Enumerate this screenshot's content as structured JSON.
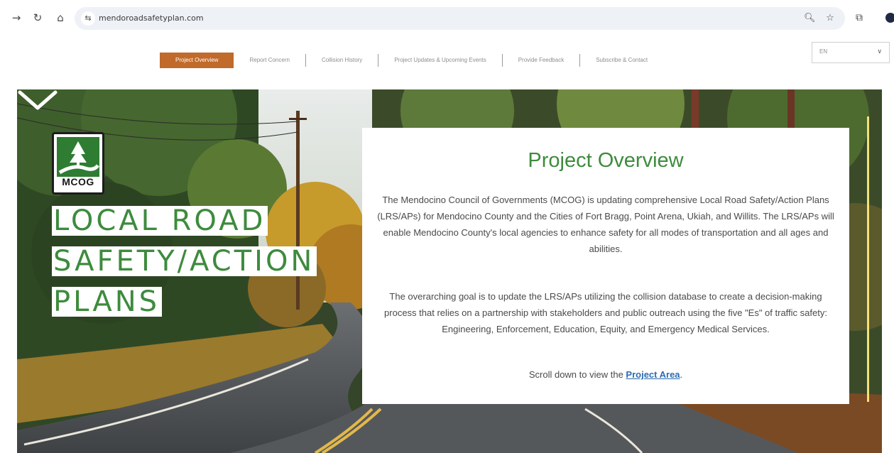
{
  "browser": {
    "url": "mendoroadsafetyplan.com",
    "icons": {
      "back": "arrow-right-icon",
      "reload": "reload-icon",
      "home": "home-icon",
      "site_settings": "tune-icon",
      "zoom": "zoom-icon",
      "bookmark": "star-icon",
      "extensions": "puzzle-icon",
      "profile": "profile-icon"
    }
  },
  "site_nav": {
    "items": [
      {
        "label": "Project Overview",
        "active": true
      },
      {
        "label": "Report Concern",
        "active": false
      },
      {
        "label": "Collision History",
        "active": false
      },
      {
        "label": "Project Updates & Upcoming Events",
        "active": false
      },
      {
        "label": "Provide Feedback",
        "active": false
      },
      {
        "label": "Subscribe & Contact",
        "active": false
      }
    ],
    "language": {
      "selected": "EN"
    }
  },
  "hero": {
    "logo_text": "MCOG",
    "title_lines": [
      "LOCAL ROAD",
      "SAFETY/ACTION",
      "PLANS"
    ]
  },
  "overview": {
    "title": "Project Overview",
    "paragraph1": "The Mendocino Council of Governments (MCOG) is updating comprehensive Local Road Safety/Action Plans (LRS/APs) for Mendocino County and the Cities of Fort Bragg, Point Arena, Ukiah, and Willits. The LRS/APs will enable Mendocino County's local agencies to enhance safety for all modes of transportation and all ages and abilities.",
    "paragraph2": "The overarching goal is to update the LRS/APs utilizing the collision database to create a decision-making process that relies on a partnership with stakeholders and public outreach using the five \"Es\" of traffic safety: Engineering, Enforcement, Education, Equity, and Emergency Medical Services.",
    "scroll_prefix": "Scroll down to view the ",
    "scroll_link": "Project Area",
    "scroll_suffix": "."
  },
  "colors": {
    "accent_orange": "#c06a2b",
    "brand_green": "#3d8b3d",
    "link_blue": "#2b6cb0"
  }
}
